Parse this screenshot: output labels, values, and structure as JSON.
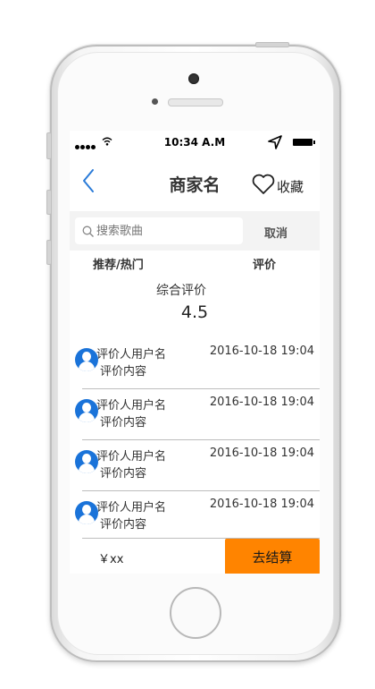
{
  "status_bar": {
    "time": "10:34 A.M"
  },
  "nav": {
    "title": "商家名",
    "favorite_label": "收藏"
  },
  "search": {
    "placeholder": "搜索歌曲",
    "cancel_label": "取消"
  },
  "tabs": [
    {
      "label": "推荐/热门"
    },
    {
      "label": "评价"
    }
  ],
  "summary": {
    "label": "综合评价",
    "score": "4.5"
  },
  "reviews": [
    {
      "user": "评价人用户名",
      "content": "评价内容",
      "date": "2016-10-18 19:04"
    },
    {
      "user": "评价人用户名",
      "content": "评价内容",
      "date": "2016-10-18 19:04"
    },
    {
      "user": "评价人用户名",
      "content": "评价内容",
      "date": "2016-10-18 19:04"
    },
    {
      "user": "评价人用户名",
      "content": "评价内容",
      "date": "2016-10-18 19:04"
    }
  ],
  "bottom": {
    "price": "￥xx",
    "checkout_label": "去结算"
  },
  "colors": {
    "accent_blue": "#1a73d9",
    "checkout_orange": "#ff8400"
  },
  "icons": [
    "back-chevron-icon",
    "heart-icon",
    "search-icon",
    "signal-icon",
    "wifi-icon",
    "location-arrow-icon",
    "battery-icon",
    "user-avatar-icon"
  ]
}
